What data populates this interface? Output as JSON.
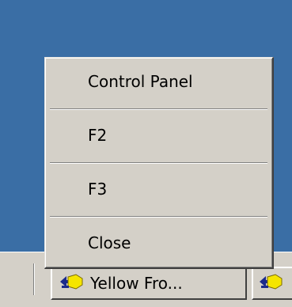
{
  "context_menu": {
    "items": [
      {
        "label": "Control Panel"
      },
      {
        "label": "F2"
      },
      {
        "label": "F3"
      },
      {
        "label": "Close"
      }
    ]
  },
  "taskbar": {
    "buttons": [
      {
        "label": "Yellow Fro...",
        "icon": "yellow-app-icon"
      },
      {
        "label": "",
        "icon": "yellow-app-icon"
      }
    ]
  },
  "colors": {
    "desktop": "#3a6ea5",
    "menu_background": "#d4d0c8",
    "icon_yellow": "#f5e500",
    "icon_blue": "#1c2b8a"
  }
}
